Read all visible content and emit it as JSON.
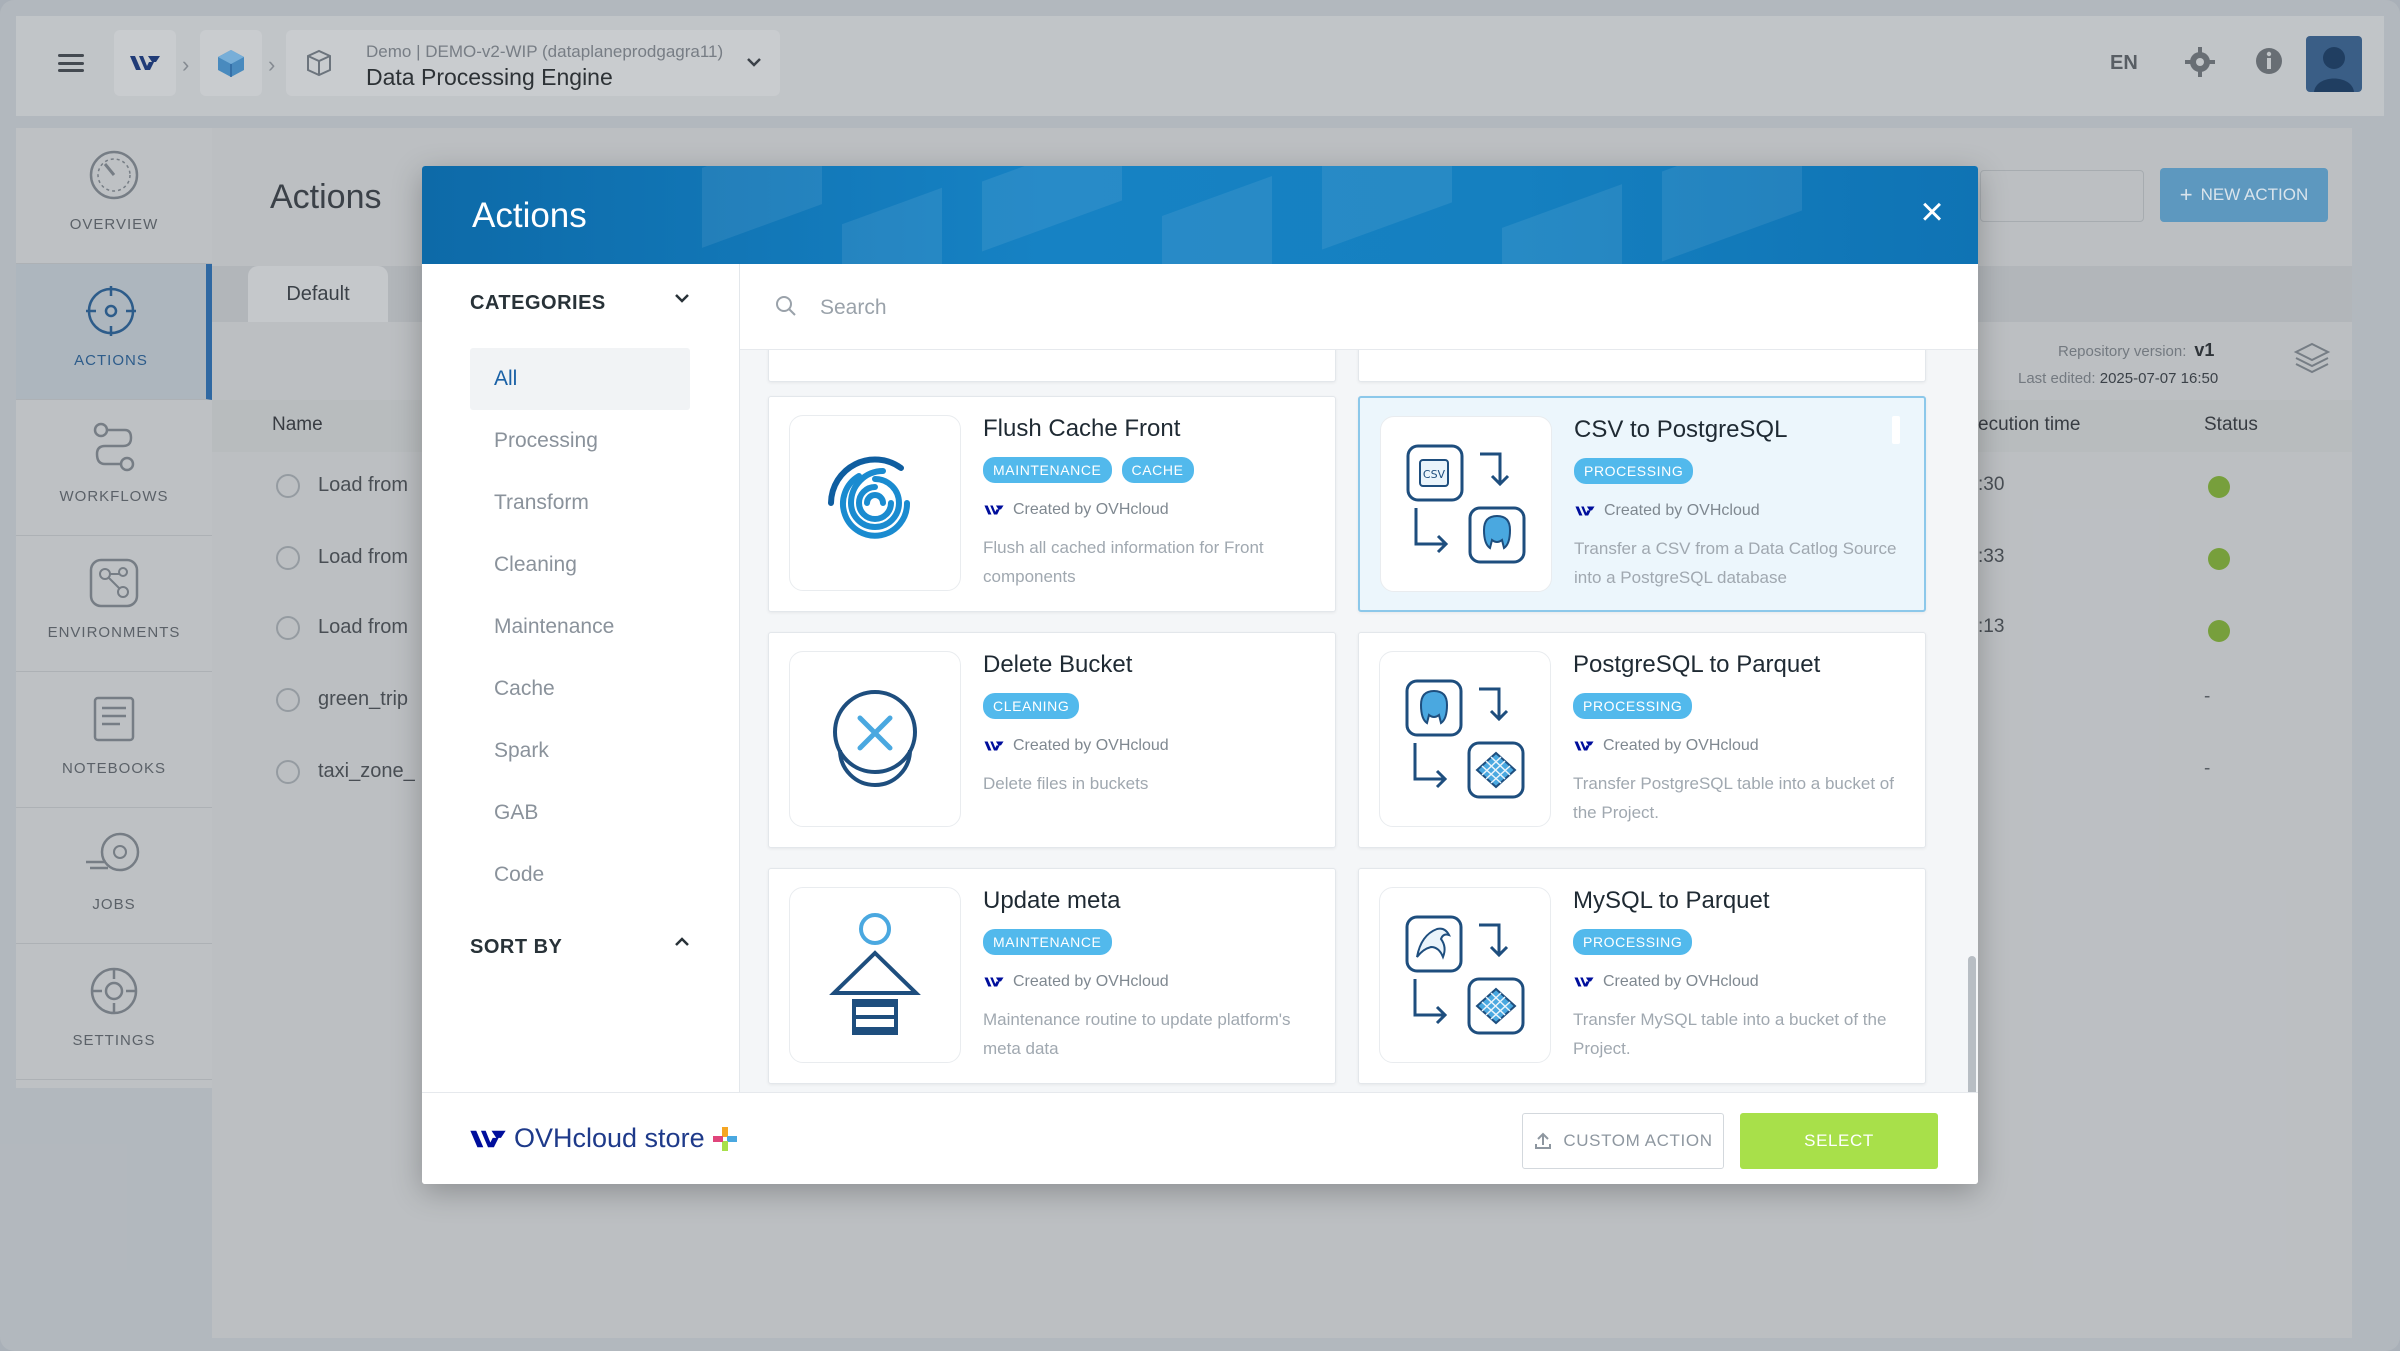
{
  "header": {
    "project_sub": "Demo | DEMO-v2-WIP (dataplaneprodgagra11)",
    "project_title": "Data Processing Engine",
    "lang": "EN"
  },
  "sidebar": {
    "items": [
      {
        "label": "OVERVIEW",
        "icon": "speedometer-icon"
      },
      {
        "label": "ACTIONS",
        "icon": "target-icon"
      },
      {
        "label": "WORKFLOWS",
        "icon": "workflow-icon"
      },
      {
        "label": "ENVIRONMENTS",
        "icon": "environment-icon"
      },
      {
        "label": "NOTEBOOKS",
        "icon": "notebook-icon"
      },
      {
        "label": "JOBS",
        "icon": "jobs-icon"
      },
      {
        "label": "SETTINGS",
        "icon": "settings-icon"
      }
    ]
  },
  "page": {
    "title": "Actions",
    "new_action": "NEW ACTION",
    "tab_default": "Default",
    "repo_version_label": "Repository version:",
    "repo_version": "v1",
    "last_edited_label": "Last edited:",
    "last_edited": "2025-07-07 16:50",
    "columns": {
      "name": "Name",
      "exec_time": "ecution time",
      "status": "Status"
    },
    "rows": [
      {
        "name": "Load from",
        "time": ":30",
        "status": "success"
      },
      {
        "name": "Load from",
        "time": ":33",
        "status": "success"
      },
      {
        "name": "Load from",
        "time": ":13",
        "status": "success"
      },
      {
        "name": "green_trip",
        "time": "",
        "status": "-"
      },
      {
        "name": "taxi_zone_",
        "time": "",
        "status": "-"
      }
    ]
  },
  "modal": {
    "title": "Actions",
    "categories_label": "CATEGORIES",
    "categories": [
      "All",
      "Processing",
      "Transform",
      "Cleaning",
      "Maintenance",
      "Cache",
      "Spark",
      "GAB",
      "Code"
    ],
    "selected_category": "All",
    "sort_label": "SORT BY",
    "search_placeholder": "Search",
    "cards": [
      {
        "title": "Flush Cache Front",
        "tags": [
          "MAINTENANCE",
          "CACHE"
        ],
        "creator": "Created by OVHcloud",
        "desc": "Flush all cached information for Front components",
        "icon": "swirl-icon",
        "selected": false
      },
      {
        "title": "CSV to PostgreSQL",
        "tags": [
          "PROCESSING"
        ],
        "creator": "Created by OVHcloud",
        "desc": "Transfer a CSV from a Data Catlog Source into a PostgreSQL database",
        "icon": "csv-to-postgres-icon",
        "selected": true
      },
      {
        "title": "Delete Bucket",
        "tags": [
          "CLEANING"
        ],
        "creator": "Created by OVHcloud",
        "desc": "Delete files in buckets",
        "icon": "delete-bucket-icon",
        "selected": false
      },
      {
        "title": "PostgreSQL to Parquet",
        "tags": [
          "PROCESSING"
        ],
        "creator": "Created by OVHcloud",
        "desc": "Transfer PostgreSQL table into a bucket of the Project.",
        "icon": "postgres-to-parquet-icon",
        "selected": false
      },
      {
        "title": "Update meta",
        "tags": [
          "MAINTENANCE"
        ],
        "creator": "Created by OVHcloud",
        "desc": "Maintenance routine to update platform's meta data",
        "icon": "update-meta-icon",
        "selected": false
      },
      {
        "title": "MySQL to Parquet",
        "tags": [
          "PROCESSING"
        ],
        "creator": "Created by OVHcloud",
        "desc": "Transfer MySQL table into a bucket of the Project.",
        "icon": "mysql-to-parquet-icon",
        "selected": false
      }
    ],
    "store_label": "OVHcloud store",
    "custom_action": "CUSTOM ACTION",
    "select": "SELECT"
  },
  "colors": {
    "accent": "#1580c0",
    "tag": "#52b9ec",
    "select_button": "#a8e04a",
    "ovh_blue": "#000e9c"
  }
}
